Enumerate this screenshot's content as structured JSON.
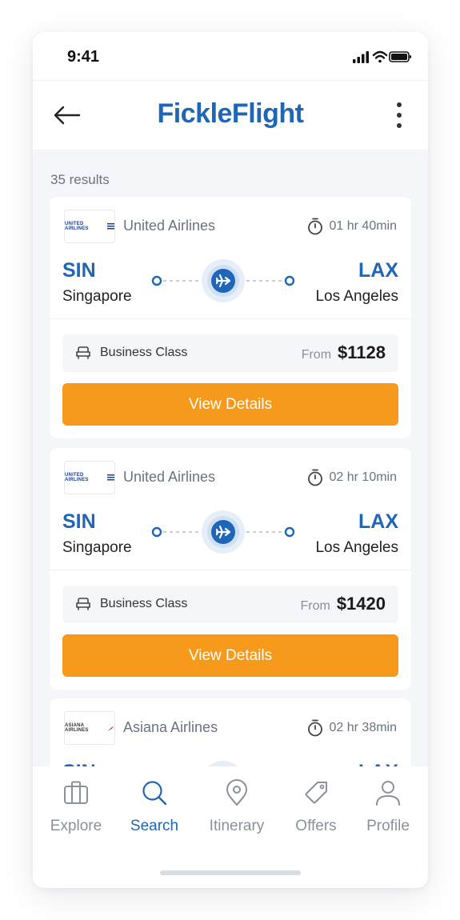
{
  "status_bar": {
    "time": "9:41"
  },
  "app_bar": {
    "logo": "FickleFlight"
  },
  "results_count": "35 results",
  "colors": {
    "brand": "#1f66b8",
    "accent": "#f7991b",
    "background": "#f4f6f9"
  },
  "flights": [
    {
      "airline_logo_text": "UNITED AIRLINES",
      "airline": "United Airlines",
      "duration": "01 hr 40min",
      "from_code": "SIN",
      "from_city": "Singapore",
      "to_code": "LAX",
      "to_city": "Los Angeles",
      "cabin_class": "Business Class",
      "price_prefix": "From",
      "price": "$1128",
      "cta": "View Details"
    },
    {
      "airline_logo_text": "UNITED AIRLINES",
      "airline": "United Airlines",
      "duration": "02 hr 10min",
      "from_code": "SIN",
      "from_city": "Singapore",
      "to_code": "LAX",
      "to_city": "Los Angeles",
      "cabin_class": "Business Class",
      "price_prefix": "From",
      "price": "$1420",
      "cta": "View Details"
    },
    {
      "airline_logo_text": "ASIANA AIRLINES",
      "airline": "Asiana Airlines",
      "duration": "02 hr 38min",
      "from_code": "SIN",
      "from_city": "",
      "to_code": "LAX",
      "to_city": "",
      "cabin_class": "",
      "price_prefix": "",
      "price": "",
      "cta": ""
    }
  ],
  "tab_bar": {
    "items": [
      {
        "label": "Explore",
        "icon": "briefcase-icon"
      },
      {
        "label": "Search",
        "icon": "search-icon",
        "active": true
      },
      {
        "label": "Itinerary",
        "icon": "map-pin-icon"
      },
      {
        "label": "Offers",
        "icon": "tag-icon"
      },
      {
        "label": "Profile",
        "icon": "user-icon"
      }
    ]
  }
}
